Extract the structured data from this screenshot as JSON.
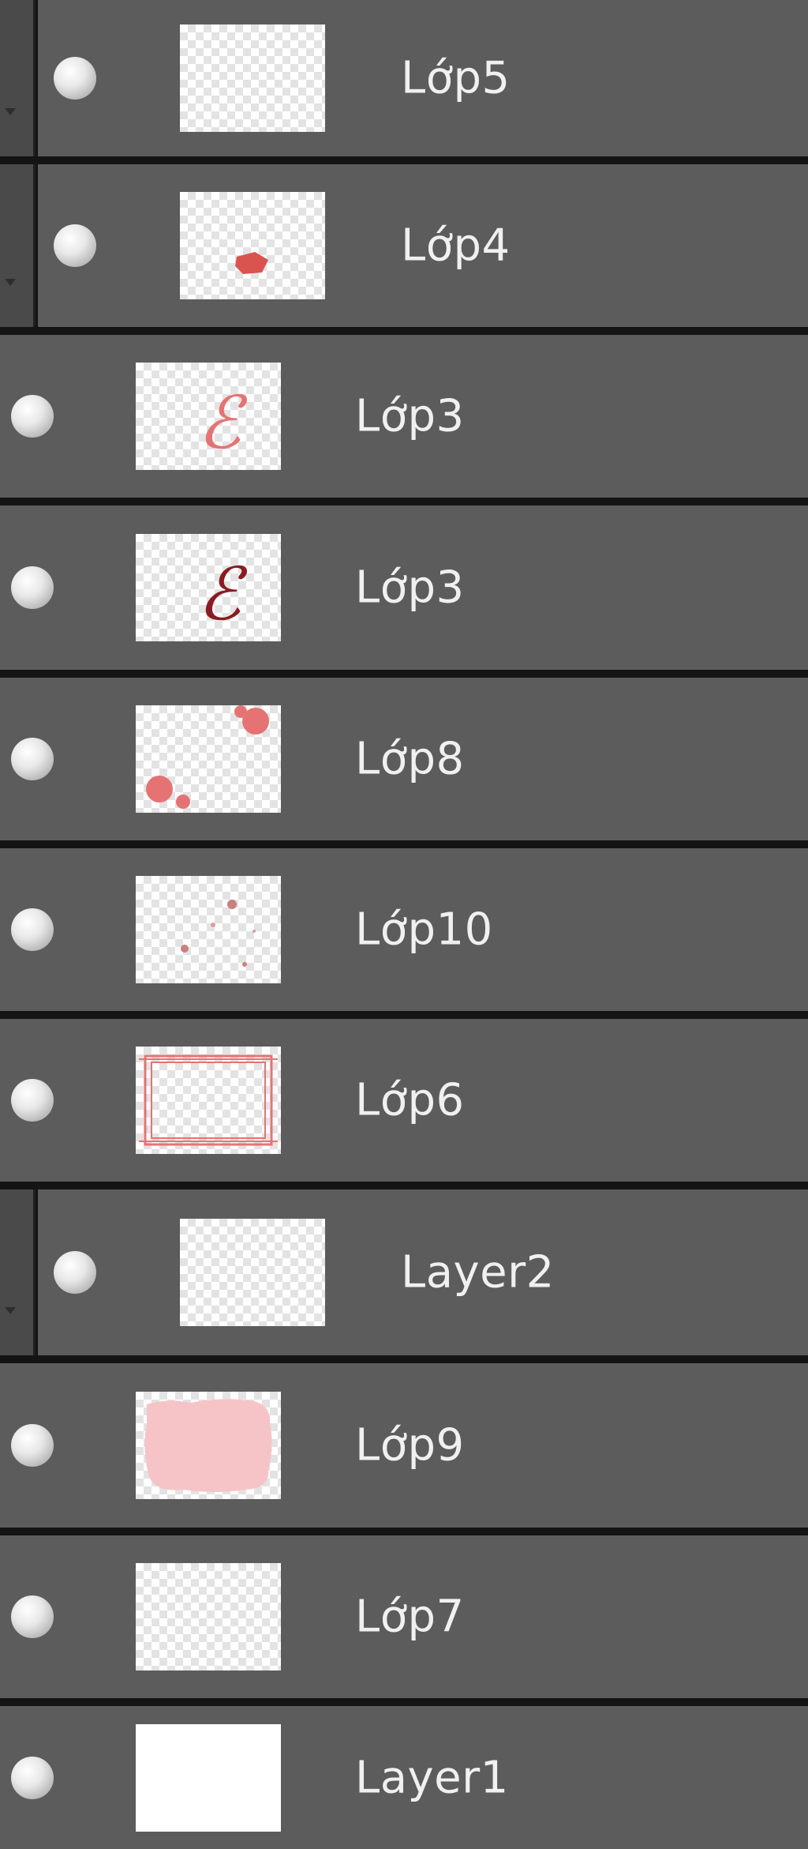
{
  "layers": [
    {
      "name": "Lớp5",
      "visible": true,
      "clipped": true,
      "thumbnail": "empty"
    },
    {
      "name": "Lớp4",
      "visible": true,
      "clipped": true,
      "thumbnail": "red-blot"
    },
    {
      "name": "Lớp3",
      "visible": true,
      "clipped": false,
      "thumbnail": "pink-letter"
    },
    {
      "name": "Lớp3",
      "visible": true,
      "clipped": false,
      "thumbnail": "dark-red-letter"
    },
    {
      "name": "Lớp8",
      "visible": true,
      "clipped": false,
      "thumbnail": "corner-spots"
    },
    {
      "name": "Lớp10",
      "visible": true,
      "clipped": false,
      "thumbnail": "faint-specks"
    },
    {
      "name": "Lớp6",
      "visible": true,
      "clipped": false,
      "thumbnail": "red-frame"
    },
    {
      "name": "Layer2",
      "visible": true,
      "clipped": true,
      "thumbnail": "empty"
    },
    {
      "name": "Lớp9",
      "visible": true,
      "clipped": false,
      "thumbnail": "pink-fill"
    },
    {
      "name": "Lớp7",
      "visible": true,
      "clipped": false,
      "thumbnail": "empty"
    },
    {
      "name": "Layer1",
      "visible": true,
      "clipped": false,
      "thumbnail": "white"
    }
  ],
  "colors": {
    "panel_bg": "#5c5c5c",
    "separator": "#141414",
    "clip_bar": "#4a4a4a",
    "text": "#f0f0f0",
    "red": "#d9534f",
    "dark_red": "#8a1c24",
    "pink": "#f6c4c7"
  }
}
